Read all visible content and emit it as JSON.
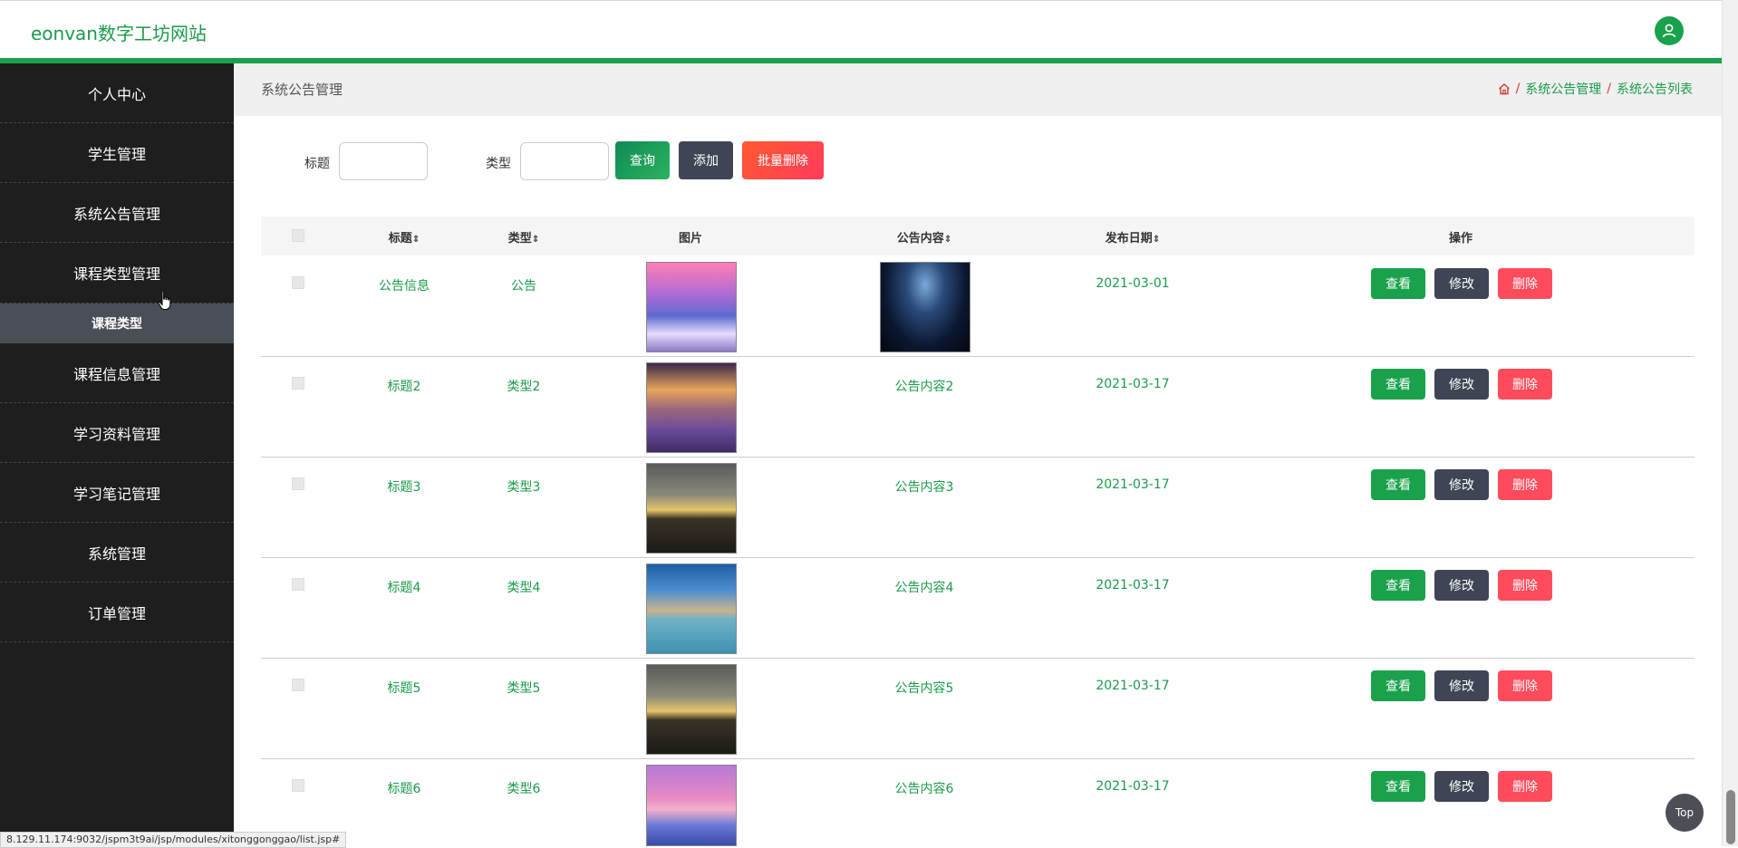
{
  "header": {
    "brand": "eonvan数字工坊网站"
  },
  "sidebar": {
    "items": [
      {
        "label": "个人中心"
      },
      {
        "label": "学生管理"
      },
      {
        "label": "系统公告管理"
      },
      {
        "label": "课程类型管理"
      },
      {
        "label": "课程类型",
        "sub": true
      },
      {
        "label": "课程信息管理"
      },
      {
        "label": "学习资料管理"
      },
      {
        "label": "学习笔记管理"
      },
      {
        "label": "系统管理"
      },
      {
        "label": "订单管理"
      }
    ]
  },
  "page": {
    "title": "系统公告管理",
    "breadcrumb": {
      "home_icon": "home-icon",
      "level1": "系统公告管理",
      "level2": "系统公告列表"
    }
  },
  "search": {
    "title_label": "标题",
    "type_label": "类型",
    "query_button": "查询",
    "add_button": "添加",
    "batch_delete_button": "批量删除"
  },
  "table": {
    "columns": {
      "title": "标题",
      "type": "类型",
      "image": "图片",
      "content": "公告内容",
      "date": "发布日期",
      "actions": "操作"
    },
    "sort_glyph": "⇕",
    "action_labels": {
      "view": "查看",
      "edit": "修改",
      "delete": "删除"
    },
    "rows": [
      {
        "title": "公告信息",
        "type": "公告",
        "image": "sunset-lake-image",
        "content": "",
        "content_image": "night-sky-image",
        "date": "2021-03-01"
      },
      {
        "title": "标题2",
        "type": "类型2",
        "image": "lavender-field-image",
        "content": "公告内容2",
        "date": "2021-03-17"
      },
      {
        "title": "标题3",
        "type": "类型3",
        "image": "tree-lake-image",
        "content": "公告内容3",
        "date": "2021-03-17"
      },
      {
        "title": "标题4",
        "type": "类型4",
        "image": "mountain-lake-image",
        "content": "公告内容4",
        "date": "2021-03-17"
      },
      {
        "title": "标题5",
        "type": "类型5",
        "image": "tree-lake-image",
        "content": "公告内容5",
        "date": "2021-03-17"
      },
      {
        "title": "标题6",
        "type": "类型6",
        "image": "pink-sunset-image",
        "content": "公告内容6",
        "date": "2021-03-17"
      }
    ]
  },
  "statusbar": {
    "url": "8.129.11.174:9032/jspm3t9ai/jsp/modules/xitonggonggao/list.jsp#"
  },
  "top_button": {
    "label": "Top"
  },
  "colors": {
    "accent": "#19a14c",
    "sidebar": "#1e1e1e",
    "danger": "#ff4b5b",
    "dark": "#3f4554"
  }
}
